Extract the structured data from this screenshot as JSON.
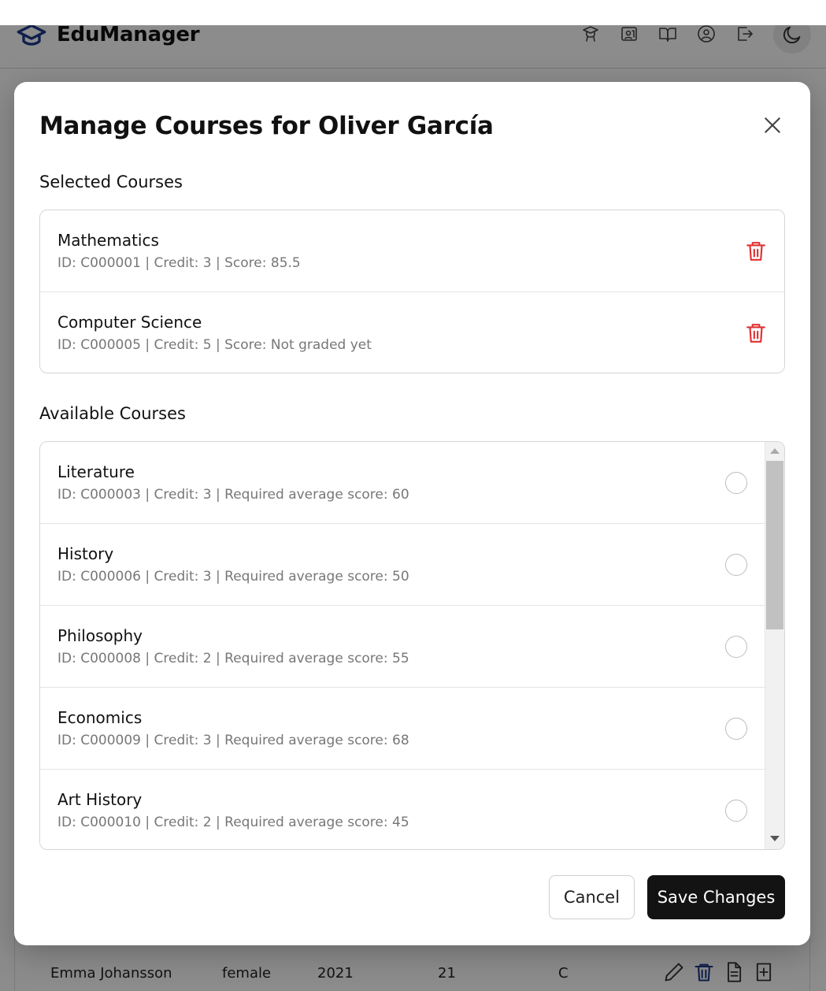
{
  "app": {
    "name": "EduManager",
    "nav_icons": [
      "graduation-cap-icon",
      "presentation-icon",
      "book-icon",
      "user-circle-icon",
      "logout-icon"
    ],
    "theme_icon": "moon-icon"
  },
  "background_row": {
    "name": "Emma Johansson",
    "gender": "female",
    "year": "2021",
    "age": "21",
    "grade": "C"
  },
  "modal": {
    "title": "Manage Courses for Oliver García",
    "selected_title": "Selected Courses",
    "available_title": "Available Courses",
    "selected_courses": [
      {
        "name": "Mathematics",
        "meta": "ID: C000001 | Credit: 3 | Score: 85.5"
      },
      {
        "name": "Computer Science",
        "meta": "ID: C000005 | Credit: 5 | Score: Not graded yet"
      }
    ],
    "available_courses": [
      {
        "name": "Literature",
        "meta": "ID: C000003 | Credit: 3 | Required average score: 60"
      },
      {
        "name": "History",
        "meta": "ID: C000006 | Credit: 3 | Required average score: 50"
      },
      {
        "name": "Philosophy",
        "meta": "ID: C000008 | Credit: 2 | Required average score: 55"
      },
      {
        "name": "Economics",
        "meta": "ID: C000009 | Credit: 3 | Required average score: 68"
      },
      {
        "name": "Art History",
        "meta": "ID: C000010 | Credit: 2 | Required average score: 45"
      }
    ],
    "cancel_label": "Cancel",
    "save_label": "Save Changes"
  },
  "colors": {
    "accent": "#1e3a8a",
    "danger": "#e03131",
    "primary_button": "#131313"
  }
}
